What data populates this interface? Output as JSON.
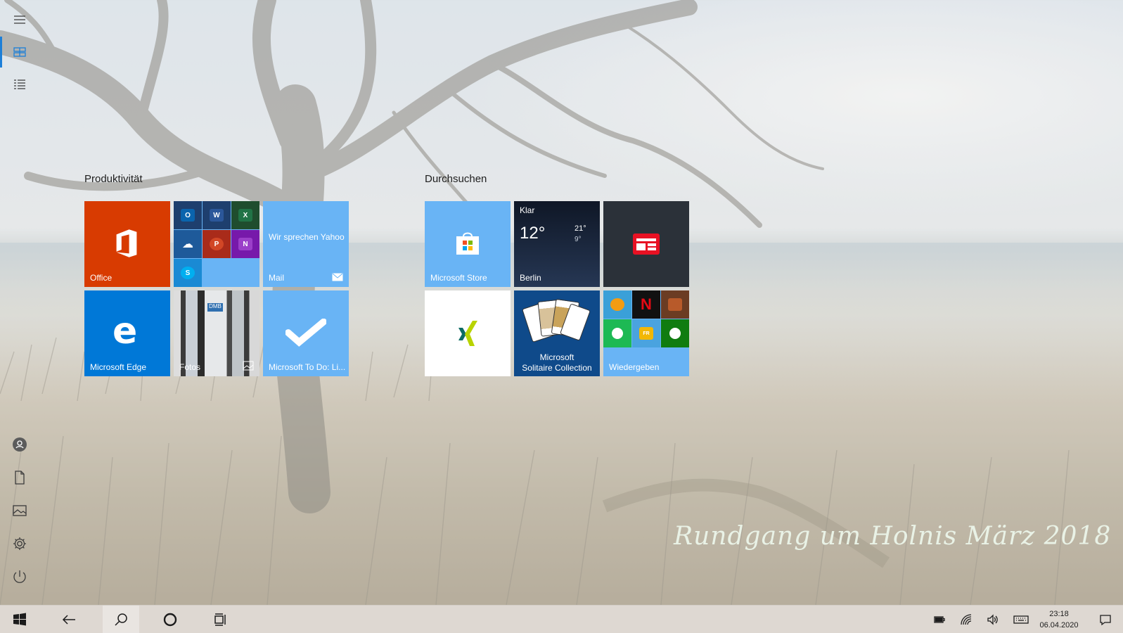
{
  "wallpaper": {
    "caption": "Rundgang um Holnis März 2018"
  },
  "rail": {
    "items": [
      {
        "name": "expand-menu",
        "icon": "hamburger-icon"
      },
      {
        "name": "pinned-tiles",
        "icon": "tiles-icon",
        "active": true
      },
      {
        "name": "all-apps",
        "icon": "list-icon"
      },
      {
        "name": "account",
        "icon": "user-icon"
      },
      {
        "name": "documents",
        "icon": "document-icon"
      },
      {
        "name": "pictures",
        "icon": "picture-icon"
      },
      {
        "name": "settings",
        "icon": "gear-icon"
      },
      {
        "name": "power",
        "icon": "power-icon"
      }
    ]
  },
  "groups": [
    {
      "title": "Produktivität",
      "tiles": [
        {
          "label": "Office",
          "color": "#d83b01",
          "icon": "office-icon"
        },
        {
          "label": "",
          "color": "#69b4f5",
          "icon": "office-apps-folder-icon",
          "apps": [
            "Outlook",
            "Word",
            "Excel",
            "OneDrive",
            "PowerPoint",
            "OneNote",
            "Skype"
          ]
        },
        {
          "label": "Mail",
          "color": "#69b4f5",
          "icon": "mail-icon",
          "text": "Wir sprechen Yahoo"
        },
        {
          "label": "Microsoft Edge",
          "color": "#0078d7",
          "icon": "edge-icon"
        },
        {
          "label": "Fotos",
          "color": "#6a6a6a",
          "icon": "photos-icon"
        },
        {
          "label": "Microsoft To Do: Li...",
          "color": "#69b4f5",
          "icon": "checkmark-icon"
        }
      ]
    },
    {
      "title": "Durchsuchen",
      "tiles": [
        {
          "label": "Microsoft Store",
          "color": "#69b4f5",
          "icon": "store-bag-icon"
        },
        {
          "label": "Berlin",
          "color": "#1a2436",
          "icon": "weather-icon",
          "condition": "Klar",
          "temp": "12°",
          "high": "21°",
          "low": "9°"
        },
        {
          "label": "",
          "color": "#2b3139",
          "icon": "news-icon"
        },
        {
          "label": "",
          "color": "#ffffff",
          "icon": "xing-icon"
        },
        {
          "label": "Microsoft Solitaire Collection",
          "label_line1": "Microsoft",
          "label_line2": "Solitaire Collection",
          "color": "#0f4a8a",
          "icon": "cards-icon"
        },
        {
          "label": "Wiedergeben",
          "color": "#69b4f5",
          "icon": "play-folder-icon"
        }
      ]
    }
  ],
  "taskbar": {
    "time": "23:18",
    "date": "06.04.2020",
    "buttons": [
      "start",
      "back",
      "search",
      "cortana",
      "task-view"
    ],
    "tray": [
      "battery",
      "wifi",
      "volume",
      "keyboard",
      "action-center"
    ]
  },
  "colors": {
    "accent": "#1d7fd8",
    "tile_blue": "#69b4f5",
    "office_red": "#d83b01",
    "edge_blue": "#0078d7"
  }
}
